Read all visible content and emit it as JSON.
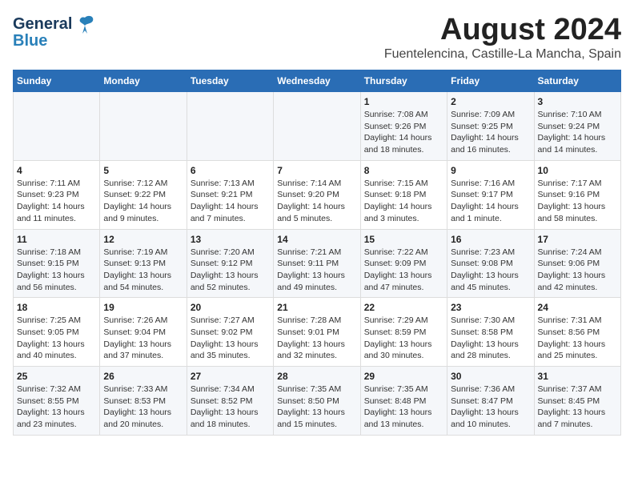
{
  "header": {
    "logo_general": "General",
    "logo_blue": "Blue",
    "title": "August 2024",
    "subtitle": "Fuentelencina, Castille-La Mancha, Spain"
  },
  "calendar": {
    "days_of_week": [
      "Sunday",
      "Monday",
      "Tuesday",
      "Wednesday",
      "Thursday",
      "Friday",
      "Saturday"
    ],
    "weeks": [
      [
        {
          "day": "",
          "info": ""
        },
        {
          "day": "",
          "info": ""
        },
        {
          "day": "",
          "info": ""
        },
        {
          "day": "",
          "info": ""
        },
        {
          "day": "1",
          "info": "Sunrise: 7:08 AM\nSunset: 9:26 PM\nDaylight: 14 hours\nand 18 minutes."
        },
        {
          "day": "2",
          "info": "Sunrise: 7:09 AM\nSunset: 9:25 PM\nDaylight: 14 hours\nand 16 minutes."
        },
        {
          "day": "3",
          "info": "Sunrise: 7:10 AM\nSunset: 9:24 PM\nDaylight: 14 hours\nand 14 minutes."
        }
      ],
      [
        {
          "day": "4",
          "info": "Sunrise: 7:11 AM\nSunset: 9:23 PM\nDaylight: 14 hours\nand 11 minutes."
        },
        {
          "day": "5",
          "info": "Sunrise: 7:12 AM\nSunset: 9:22 PM\nDaylight: 14 hours\nand 9 minutes."
        },
        {
          "day": "6",
          "info": "Sunrise: 7:13 AM\nSunset: 9:21 PM\nDaylight: 14 hours\nand 7 minutes."
        },
        {
          "day": "7",
          "info": "Sunrise: 7:14 AM\nSunset: 9:20 PM\nDaylight: 14 hours\nand 5 minutes."
        },
        {
          "day": "8",
          "info": "Sunrise: 7:15 AM\nSunset: 9:18 PM\nDaylight: 14 hours\nand 3 minutes."
        },
        {
          "day": "9",
          "info": "Sunrise: 7:16 AM\nSunset: 9:17 PM\nDaylight: 14 hours\nand 1 minute."
        },
        {
          "day": "10",
          "info": "Sunrise: 7:17 AM\nSunset: 9:16 PM\nDaylight: 13 hours\nand 58 minutes."
        }
      ],
      [
        {
          "day": "11",
          "info": "Sunrise: 7:18 AM\nSunset: 9:15 PM\nDaylight: 13 hours\nand 56 minutes."
        },
        {
          "day": "12",
          "info": "Sunrise: 7:19 AM\nSunset: 9:13 PM\nDaylight: 13 hours\nand 54 minutes."
        },
        {
          "day": "13",
          "info": "Sunrise: 7:20 AM\nSunset: 9:12 PM\nDaylight: 13 hours\nand 52 minutes."
        },
        {
          "day": "14",
          "info": "Sunrise: 7:21 AM\nSunset: 9:11 PM\nDaylight: 13 hours\nand 49 minutes."
        },
        {
          "day": "15",
          "info": "Sunrise: 7:22 AM\nSunset: 9:09 PM\nDaylight: 13 hours\nand 47 minutes."
        },
        {
          "day": "16",
          "info": "Sunrise: 7:23 AM\nSunset: 9:08 PM\nDaylight: 13 hours\nand 45 minutes."
        },
        {
          "day": "17",
          "info": "Sunrise: 7:24 AM\nSunset: 9:06 PM\nDaylight: 13 hours\nand 42 minutes."
        }
      ],
      [
        {
          "day": "18",
          "info": "Sunrise: 7:25 AM\nSunset: 9:05 PM\nDaylight: 13 hours\nand 40 minutes."
        },
        {
          "day": "19",
          "info": "Sunrise: 7:26 AM\nSunset: 9:04 PM\nDaylight: 13 hours\nand 37 minutes."
        },
        {
          "day": "20",
          "info": "Sunrise: 7:27 AM\nSunset: 9:02 PM\nDaylight: 13 hours\nand 35 minutes."
        },
        {
          "day": "21",
          "info": "Sunrise: 7:28 AM\nSunset: 9:01 PM\nDaylight: 13 hours\nand 32 minutes."
        },
        {
          "day": "22",
          "info": "Sunrise: 7:29 AM\nSunset: 8:59 PM\nDaylight: 13 hours\nand 30 minutes."
        },
        {
          "day": "23",
          "info": "Sunrise: 7:30 AM\nSunset: 8:58 PM\nDaylight: 13 hours\nand 28 minutes."
        },
        {
          "day": "24",
          "info": "Sunrise: 7:31 AM\nSunset: 8:56 PM\nDaylight: 13 hours\nand 25 minutes."
        }
      ],
      [
        {
          "day": "25",
          "info": "Sunrise: 7:32 AM\nSunset: 8:55 PM\nDaylight: 13 hours\nand 23 minutes."
        },
        {
          "day": "26",
          "info": "Sunrise: 7:33 AM\nSunset: 8:53 PM\nDaylight: 13 hours\nand 20 minutes."
        },
        {
          "day": "27",
          "info": "Sunrise: 7:34 AM\nSunset: 8:52 PM\nDaylight: 13 hours\nand 18 minutes."
        },
        {
          "day": "28",
          "info": "Sunrise: 7:35 AM\nSunset: 8:50 PM\nDaylight: 13 hours\nand 15 minutes."
        },
        {
          "day": "29",
          "info": "Sunrise: 7:35 AM\nSunset: 8:48 PM\nDaylight: 13 hours\nand 13 minutes."
        },
        {
          "day": "30",
          "info": "Sunrise: 7:36 AM\nSunset: 8:47 PM\nDaylight: 13 hours\nand 10 minutes."
        },
        {
          "day": "31",
          "info": "Sunrise: 7:37 AM\nSunset: 8:45 PM\nDaylight: 13 hours\nand 7 minutes."
        }
      ]
    ]
  }
}
